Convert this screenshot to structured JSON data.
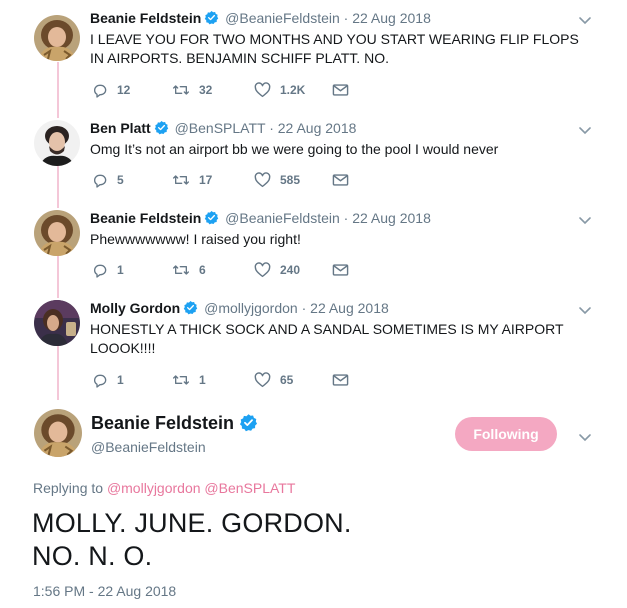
{
  "colors": {
    "accent": "#e8779d",
    "thread_line": "#f4c7d8",
    "follow_button_bg": "#f4a8c2",
    "verified_blue": "#1da1f2",
    "muted_text": "#657786"
  },
  "thread": [
    {
      "name": "Beanie Feldstein",
      "verified": true,
      "handle": "@BeanieFeldstein",
      "separator": "·",
      "date": "22 Aug 2018",
      "text": "I LEAVE YOU FOR TWO MONTHS AND YOU START WEARING FLIP FLOPS IN AIRPORTS. BENJAMIN SCHIFF PLATT. NO.",
      "replies": "12",
      "retweets": "32",
      "likes": "1.2K",
      "icons": [
        "reply-icon",
        "retweet-icon",
        "heart-icon",
        "message-icon",
        "chevron-down-icon"
      ]
    },
    {
      "name": "Ben Platt",
      "verified": true,
      "handle": "@BenSPLATT",
      "separator": "·",
      "date": "22 Aug 2018",
      "text": "Omg It’s not an airport bb we were going to the pool I would never",
      "replies": "5",
      "retweets": "17",
      "likes": "585"
    },
    {
      "name": "Beanie Feldstein",
      "verified": true,
      "handle": "@BeanieFeldstein",
      "separator": "·",
      "date": "22 Aug 2018",
      "text": "Phewwwwwww! I raised you right!",
      "replies": "1",
      "retweets": "6",
      "likes": "240"
    },
    {
      "name": "Molly Gordon",
      "verified": true,
      "handle": "@mollyjgordon",
      "separator": "·",
      "date": "22 Aug 2018",
      "text": "HONESTLY A THICK SOCK AND A SANDAL SOMETIMES IS MY AIRPORT LOOOK!!!!",
      "replies": "1",
      "retweets": "1",
      "likes": "65"
    }
  ],
  "main_tweet": {
    "name": "Beanie Feldstein",
    "verified": true,
    "handle": "@BeanieFeldstein",
    "follow_label": "Following",
    "replying_prefix": "Replying to",
    "mention_1": "@mollyjgordon",
    "mention_2": "@BenSPLATT",
    "text_line_1": "MOLLY. JUNE. GORDON.",
    "text_line_2": "NO. N. O.",
    "timestamp": "1:56 PM - 22 Aug 2018"
  }
}
